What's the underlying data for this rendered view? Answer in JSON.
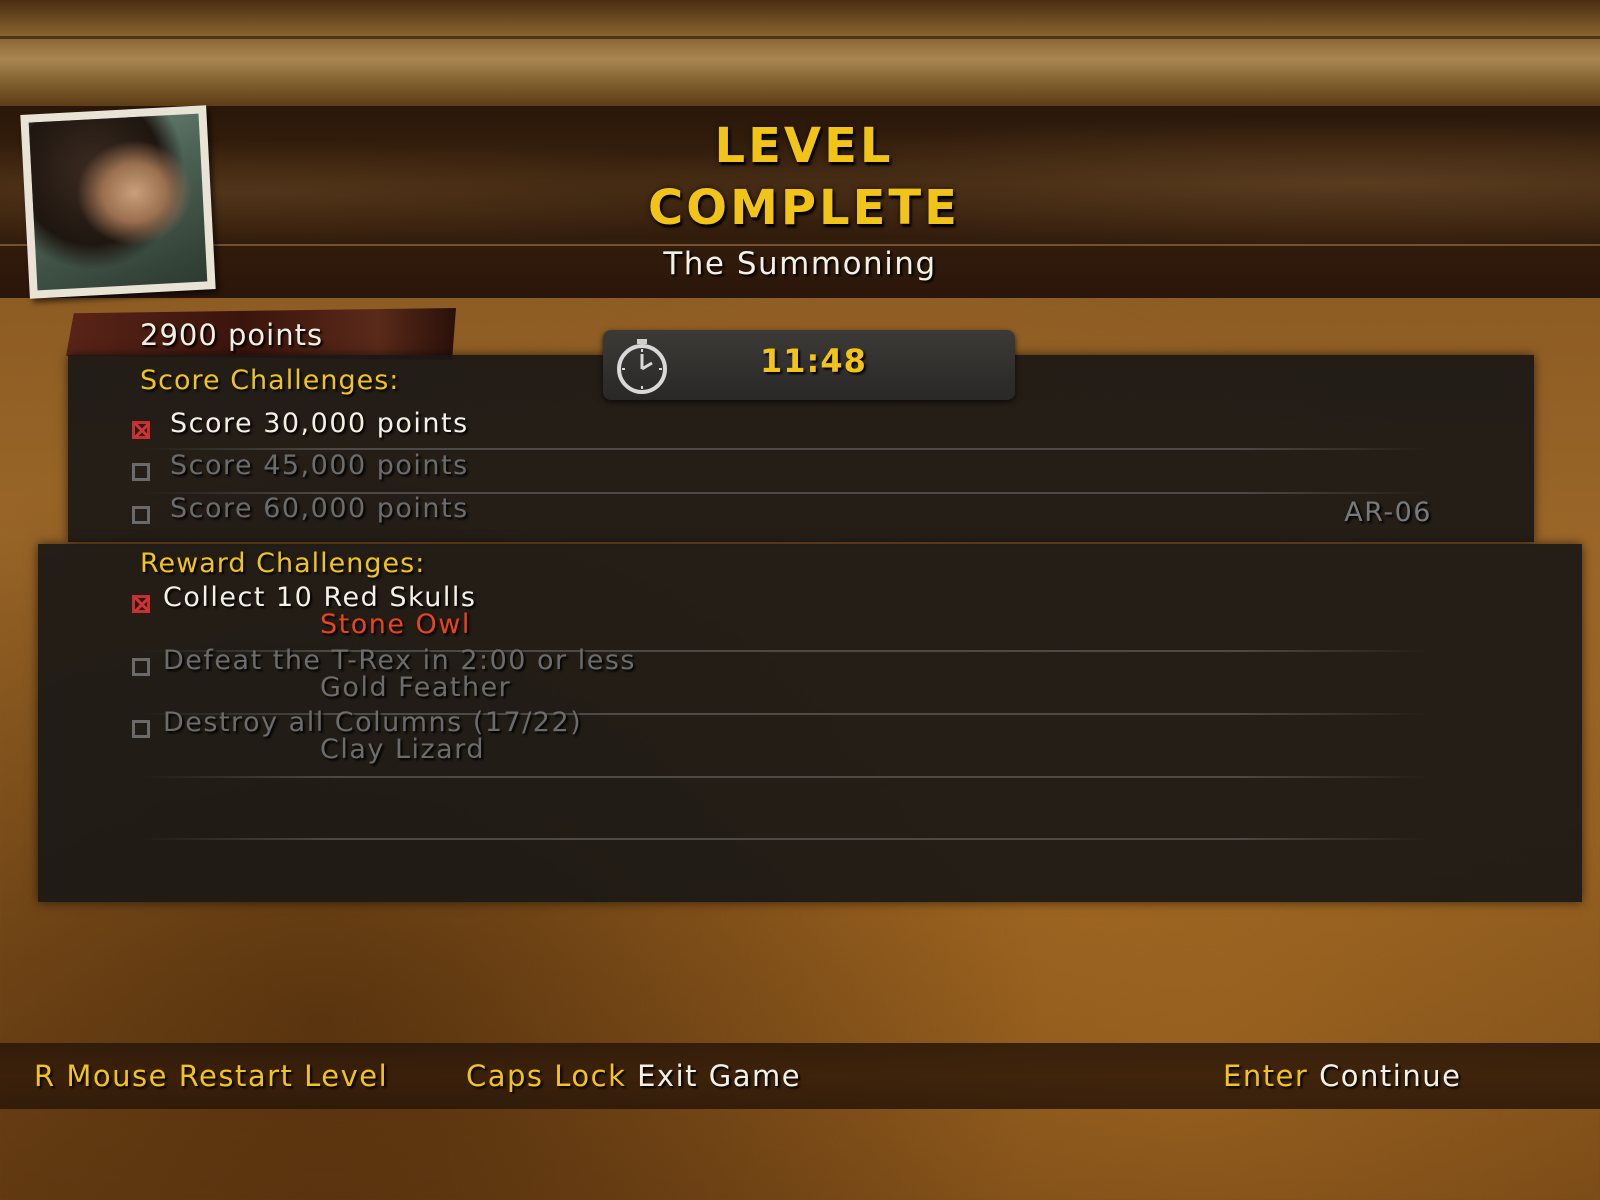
{
  "header": {
    "title_line1": "LEVEL",
    "title_line2": "COMPLETE",
    "level_name": "The Summoning"
  },
  "points": "2900 points",
  "timer": "11:48",
  "score_challenges": {
    "heading": "Score Challenges:",
    "items": [
      {
        "label": "Score 30,000 points",
        "completed": true
      },
      {
        "label": "Score 45,000 points",
        "completed": false
      },
      {
        "label": "Score 60,000 points",
        "completed": false
      }
    ],
    "code": "AR-06"
  },
  "reward_challenges": {
    "heading": "Reward Challenges:",
    "items": [
      {
        "label": "Collect 10 Red Skulls",
        "reward": "Stone Owl",
        "completed": true
      },
      {
        "label": "Defeat the T-Rex in 2:00 or less",
        "reward": "Gold Feather",
        "completed": false
      },
      {
        "label": "Destroy all Columns (17/22)",
        "reward": "Clay Lizard",
        "completed": false
      }
    ]
  },
  "footer": {
    "restart": {
      "key": "R Mouse",
      "action": "Restart Level"
    },
    "exit": {
      "key": "Caps Lock",
      "action": "Exit Game"
    },
    "continue": {
      "key": "Enter",
      "action": "Continue"
    }
  },
  "colors": {
    "accent_gold": "#f2c418",
    "reward_orange": "#e9441c",
    "check_red": "#d43232"
  }
}
